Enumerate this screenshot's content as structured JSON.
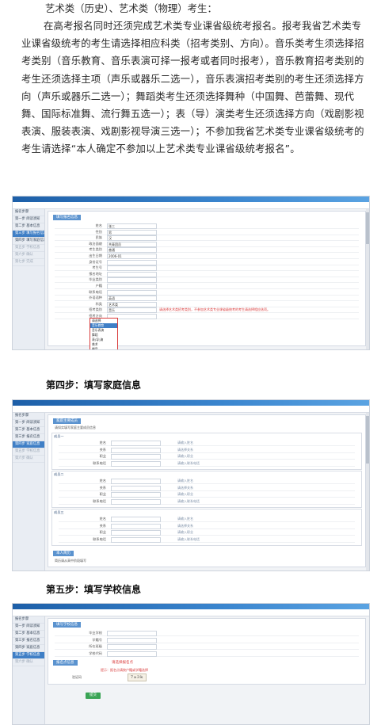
{
  "article": {
    "line1": "艺术类（历史）、艺术类（物理）考生：",
    "para": "在高考报名同时还须完成艺术类专业课省级统考报名。报考我省艺术类专业课省级统考的考生请选择相应科类（招考类别、方向）。音乐类考生须选择招考类别（音乐教育、音乐表演可择一报考或者同时报考），音乐教育招考类别的考生还须选择主项（声乐或器乐二选一），音乐表演招考类别的考生还须选择方向（声乐或器乐二选一）；舞蹈类考生还须选择舞种（中国舞、芭蕾舞、现代舞、国际标准舞、流行舞五选一）；表（导）演类考生还须选择方向（戏剧影视表演、服装表演、戏剧影视导演三选一）；不参加我省艺术类专业课省级统考的考生请选择“本人确定不参加以上艺术类专业课省级统考报名”。",
    "step4": "第四步：填写家庭信息",
    "step5": "第五步：填写学校信息"
  },
  "screens": {
    "s1": {
      "sidebar": [
        "报名步骤",
        "第一步 阅读须知",
        "第二步 基本信息",
        "第三步 填写报名信息",
        "第四步 填写家庭信息",
        "第五步 学校信息",
        "第六步 确认",
        "第七步 完成"
      ],
      "section": "填写报名信息",
      "rows": [
        {
          "k": "姓名",
          "v": "张三"
        },
        {
          "k": "性别",
          "v": "男"
        },
        {
          "k": "民族",
          "v": "汉"
        },
        {
          "k": "政治面貌",
          "v": "共青团员"
        },
        {
          "k": "考生类别",
          "v": "普通"
        },
        {
          "k": "出生日期",
          "v": "2006-01"
        },
        {
          "k": "身份证号",
          "v": ""
        },
        {
          "k": "考生号",
          "v": ""
        },
        {
          "k": "报名地址",
          "v": ""
        },
        {
          "k": "毕业类别",
          "v": ""
        },
        {
          "k": "户籍",
          "v": ""
        },
        {
          "k": "联系电话",
          "v": ""
        },
        {
          "k": "外语语种",
          "v": "英语"
        },
        {
          "k": "科类",
          "v": "艺术类"
        },
        {
          "k": "招考类别",
          "v": "音乐"
        },
        {
          "k": "招考方向",
          "v": ""
        }
      ],
      "note": "请选择艺术类招考类别，不参加艺术类专业课省级统考的考生请选择相应选项。",
      "dropdown": [
        "请选择",
        "音乐教育",
        "音乐表演",
        "舞蹈",
        "表(导)演",
        "美术",
        "播音",
        "书法",
        "本人确定不参加"
      ]
    },
    "s2": {
      "sidebar": [
        "报名步骤",
        "第一步 阅读须知",
        "第二步 基本信息",
        "第三步 报名信息",
        "第四步 家庭信息",
        "第五步 学校信息",
        "第六步 确认"
      ],
      "section": "家庭主要成员",
      "hint": "请如实填写家庭主要成员信息",
      "blocks": [
        "成员一",
        "成员二",
        "成员三"
      ],
      "fields": [
        "姓名",
        "关系",
        "职业",
        "联系电话"
      ],
      "notes": [
        "请输入姓名",
        "请选择关系",
        "请输入职业",
        "请输入联系电话"
      ],
      "section2": "本人简历",
      "footer": "简历请从高中阶段填写"
    },
    "s3": {
      "sidebar": [
        "报名步骤",
        "第一步 阅读须知",
        "第二步 基本信息",
        "第三步 报名信息",
        "第四步 家庭信息",
        "第五步 学校信息",
        "第六步 确认"
      ],
      "section": "填写学校信息",
      "rows": [
        {
          "k": "毕业学校",
          "v": ""
        },
        {
          "k": "学籍号",
          "v": ""
        },
        {
          "k": "所在班级",
          "v": ""
        },
        {
          "k": "学校代码",
          "v": ""
        }
      ],
      "section2": "报名点信息",
      "red": "请选择报名点",
      "hint": "提示：报名点请按户籍或学籍选择",
      "captcha_label": "验证码",
      "captcha": "7a3k",
      "submit": "提交"
    }
  },
  "colors": {
    "accent": "#3f7fc6",
    "topbar": "#1d5fa8",
    "warn": "#d93b3b",
    "ok": "#3aa455"
  }
}
